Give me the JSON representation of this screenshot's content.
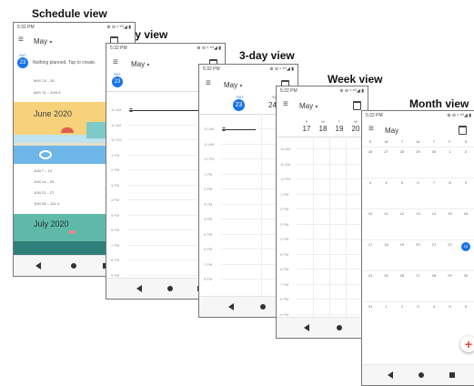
{
  "labels": {
    "schedule": "Schedule view",
    "day": "Day view",
    "three_day": "3-day view",
    "week": "Week view",
    "month": "Month view"
  },
  "status": {
    "time": "5:32 PM",
    "icons": "⊕ ⊖ ᵛ ⁵ᴳ◢ ▮"
  },
  "ui": {
    "menu": "≡",
    "month": "May",
    "caret": "▾",
    "kebab": "⋮"
  },
  "schedule": {
    "day_name": "SAT",
    "day_num": "23",
    "empty": "Nothing planned. Tap to create.",
    "weeks_a": [
      "MAY 24 – 30",
      "MAY 31 – JUN 6"
    ],
    "june": "June 2020",
    "weeks_b": [
      "JUN 7 – 13",
      "JUN 14 – 20",
      "JUN 21 – 27",
      "JUN 28 – JUL 4"
    ],
    "july": "July 2020"
  },
  "day": {
    "day_name": "SAT",
    "day_num": "23",
    "hours": [
      "10 AM",
      "11 AM",
      "12 PM",
      "1 PM",
      "2 PM",
      "3 PM",
      "4 PM",
      "5 PM",
      "6 PM",
      "7 PM",
      "8 PM",
      "9 PM"
    ]
  },
  "three_day": {
    "d1": {
      "name": "SAT",
      "num": "23"
    },
    "d2": {
      "name": "SUN",
      "num": "24"
    },
    "hours": [
      "10 AM",
      "11 AM",
      "12 PM",
      "1 PM",
      "2 PM",
      "3 PM",
      "4 PM",
      "5 PM",
      "6 PM",
      "7 PM",
      "8 PM"
    ]
  },
  "week": {
    "dows": [
      "S",
      "M",
      "T",
      "W"
    ],
    "nums": [
      "17",
      "18",
      "19",
      "20"
    ],
    "hours": [
      "10 AM",
      "11 AM",
      "12 PM",
      "1 PM",
      "2 PM",
      "3 PM",
      "4 PM",
      "5 PM",
      "6 PM",
      "7 PM",
      "8 PM",
      "9 PM"
    ]
  },
  "month": {
    "dows": [
      "S",
      "M",
      "T",
      "W",
      "T",
      "F",
      "S"
    ],
    "rows": [
      [
        "26",
        "27",
        "28",
        "29",
        "30",
        "1",
        "2"
      ],
      [
        "3",
        "4",
        "5",
        "6",
        "7",
        "8",
        "9"
      ],
      [
        "10",
        "11",
        "12",
        "13",
        "14",
        "15",
        "16"
      ],
      [
        "17",
        "18",
        "19",
        "20",
        "21",
        "22",
        "23"
      ],
      [
        "24",
        "25",
        "26",
        "27",
        "28",
        "29",
        "30"
      ],
      [
        "31",
        "1",
        "2",
        "3",
        "4",
        "5",
        "6"
      ]
    ],
    "today": "23",
    "fab": "+"
  },
  "colors": {
    "accent": "#1a73e8",
    "june_bg": "#f7d27a",
    "july_bg": "#5fb9a8"
  }
}
